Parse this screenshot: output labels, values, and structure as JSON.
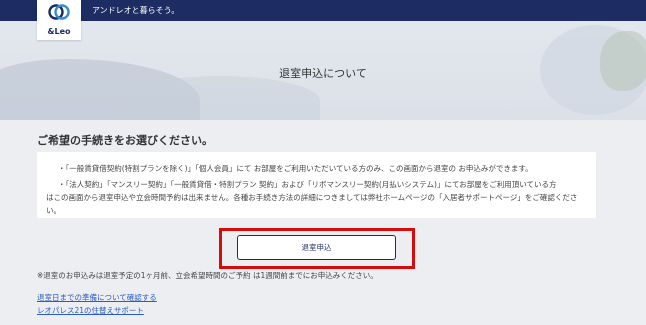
{
  "header": {
    "logo_text": "&Leo",
    "tagline": "アンドレオと暮らそう。"
  },
  "hero": {
    "title": "退室申込について"
  },
  "main": {
    "section_title": "ご希望の手続きをお選びください。",
    "notices": [
      {
        "bullet": "・",
        "text": "「一般賃貸借契約(特割プランを除く)」「個人会員」にて お部屋をご利用いただいている方のみ、この画面から退室の お申込みができます。",
        "line2": ""
      },
      {
        "bullet": "・",
        "text": "「法人契約」「マンスリー契約」「一般賃貸借・特割プラン 契約」および「リボマンスリー契約(月払いシステム)」にてお部屋をご利用頂いている方",
        "line2": "はこの画面から退室申込や立会時間予約は出来ません。各種お手続き方法の詳細につきましては弊社ホームページの「入居者サポートページ」をご確認ください。"
      }
    ],
    "apply_button_label": "退室申込",
    "note": "※退室のお申込みは退室予定の1ヶ月前、立会希望時間のご予約 は1週間前までにお申込みください。",
    "links": [
      "退室日までの準備について確認する",
      "レオパレス21の住替えサポート"
    ]
  },
  "colors": {
    "navy": "#1d2c63",
    "highlight_red": "#d60b0b",
    "link_blue": "#2a5bbf"
  }
}
